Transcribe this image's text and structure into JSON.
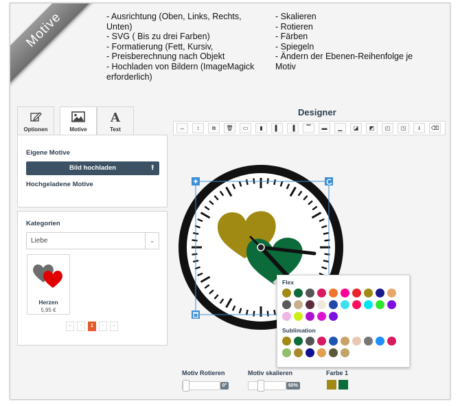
{
  "banner": {
    "label": "Motive"
  },
  "features": {
    "col1": [
      "- Ausrichtung (Oben, Links, Rechts,",
      "Unten)",
      "- SVG ( Bis zu drei Farben)",
      "- Formatierung (Fett, Kursiv,",
      "- Preisberechnung nach Objekt",
      "- Hochladen von Bildern (ImageMagick",
      "erforderlich)"
    ],
    "col2": [
      "- Skalieren",
      "- Rotieren",
      "- Färben",
      "- Spiegeln",
      "- Ändern der Ebenen-Reihenfolge je",
      "Motiv"
    ]
  },
  "tabs": [
    {
      "label": "Optionen",
      "icon": "edit-icon"
    },
    {
      "label": "Motive",
      "icon": "image-icon"
    },
    {
      "label": "Text",
      "icon": "text-icon"
    }
  ],
  "motive_panel": {
    "own_title": "Eigene Motive",
    "upload_button": "Bild hochladen",
    "uploaded_title": "Hochgeladene Motive"
  },
  "categories": {
    "title": "Kategorien",
    "selected": "Liebe",
    "product": {
      "name": "Herzen",
      "price": "5,95 €"
    },
    "pager": {
      "first": "«",
      "prev": "‹",
      "current": "1",
      "next": "›",
      "last": "»"
    }
  },
  "designer": {
    "title": "Designer",
    "toolbar_icons": [
      "resize-width-icon",
      "resize-height-icon",
      "duplicate-icon",
      "delete-icon",
      "align-left-icon",
      "align-center-icon",
      "align-right-icon",
      "align-top-left-icon",
      "align-top-icon",
      "align-middle-icon",
      "align-bottom-icon",
      "layer-down-icon",
      "layer-up-icon",
      "bring-front-icon",
      "send-back-icon",
      "download-icon",
      "eraser-icon"
    ]
  },
  "color_picker": {
    "flex_title": "Flex",
    "flex_colors": [
      "#a08a14",
      "#0b6b3a",
      "#555555",
      "#d81b60",
      "#f0742c",
      "#ff0099",
      "#e9242b",
      "#a08a14",
      "#1a1a8c",
      "#e8a86b",
      "#5a5a5a",
      "#c7b08c",
      "#5b2d3b",
      "#efe9dd",
      "#2346a8",
      "#3ee0f0",
      "#ff0f5a",
      "#00e6f0",
      "#2ee62e",
      "#7b12e0",
      "#efb6e6",
      "#ccef1a",
      "#b010d0",
      "#e010d0",
      "#7a0fe0"
    ],
    "sublimation_title": "Sublimation",
    "sublimation_colors": [
      "#a08a14",
      "#0b6b3a",
      "#555555",
      "#d81b60",
      "#1f56b3",
      "#c8a16a",
      "#e8c8b4",
      "#777777",
      "#1e90ff",
      "#d81b60",
      "#8fbf6a",
      "#a88a2a",
      "#101090",
      "#e0a050",
      "#5a5a3a",
      "#c2a46a"
    ]
  },
  "controls": {
    "rotate_label": "Motiv Rotieren",
    "rotate_value": "0°",
    "rotate_fraction": 0.0,
    "scale_label": "Motiv skalieren",
    "scale_value": "60%",
    "scale_fraction": 0.3,
    "color_label": "Farbe 1",
    "color_swatches": [
      "#a08a14",
      "#0b6b3a"
    ]
  }
}
